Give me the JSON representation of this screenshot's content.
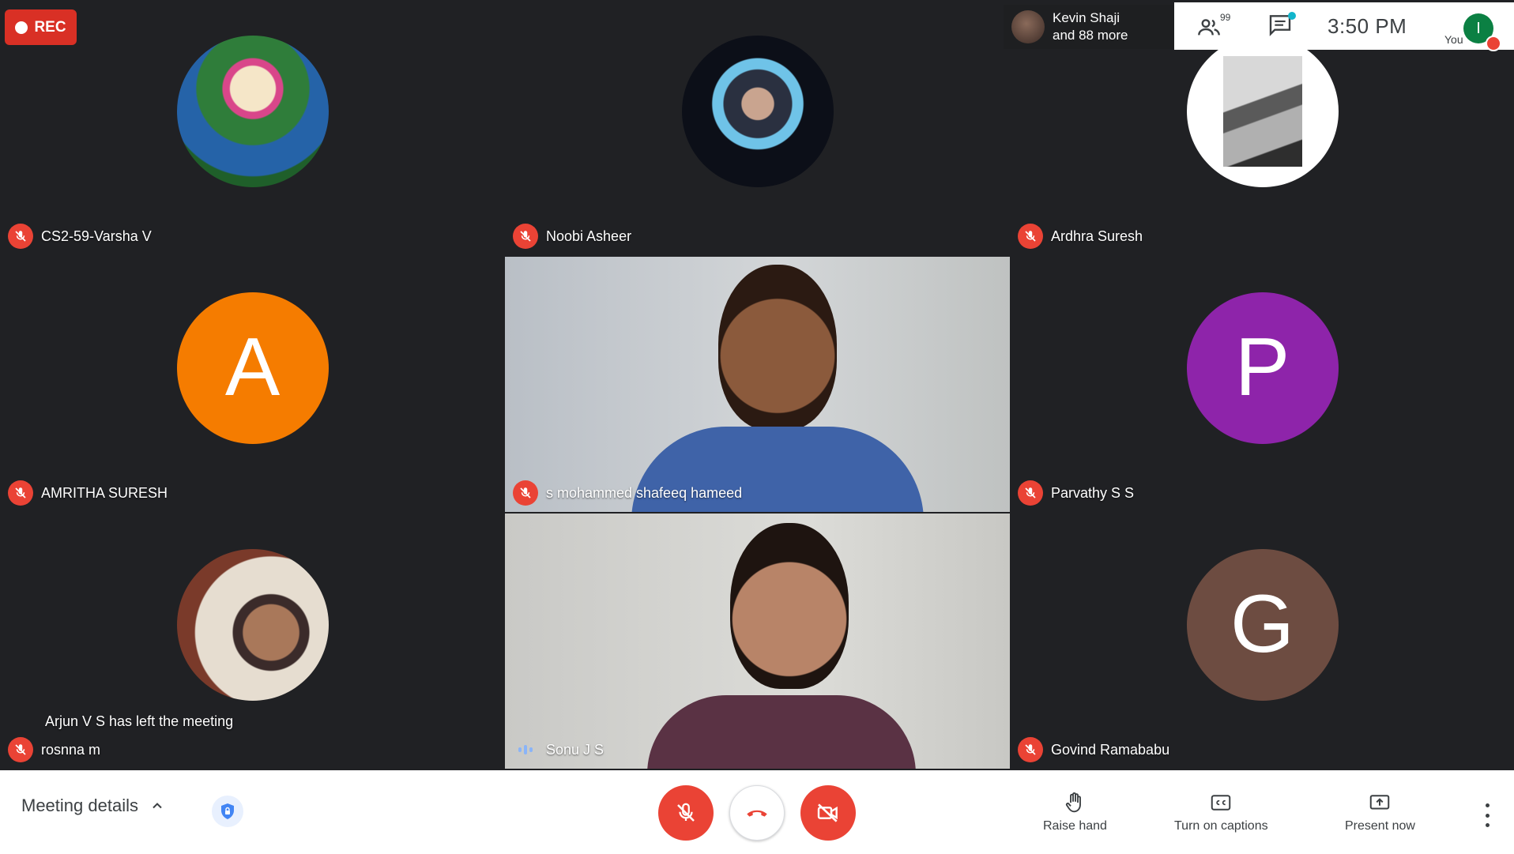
{
  "rec_label": "REC",
  "presenter": {
    "line1": "Kevin Shaji",
    "line2": "and 88 more"
  },
  "topbar": {
    "people_count": "99",
    "time": "3:50  PM",
    "you_label": "You",
    "you_initial": "I"
  },
  "participants": [
    {
      "name": "CS2-59-Varsha V",
      "kind": "photo",
      "mic": "muted"
    },
    {
      "name": "Noobi Asheer",
      "kind": "photo",
      "mic": "muted"
    },
    {
      "name": "Ardhra Suresh",
      "kind": "photo",
      "mic": "muted"
    },
    {
      "name": "AMRITHA SURESH",
      "kind": "letter",
      "initial": "A",
      "color": "#f57c00",
      "mic": "muted"
    },
    {
      "name": "s mohammed shafeeq hameed",
      "kind": "video",
      "mic": "muted"
    },
    {
      "name": "Parvathy S S",
      "kind": "letter",
      "initial": "P",
      "color": "#8e24aa",
      "mic": "muted"
    },
    {
      "name": "rosnna m",
      "kind": "photo",
      "mic": "muted"
    },
    {
      "name": "Sonu J S",
      "kind": "video",
      "mic": "speaking"
    },
    {
      "name": "Govind Ramababu",
      "kind": "letter",
      "initial": "G",
      "color": "#6d4c41",
      "mic": "muted"
    }
  ],
  "toast": "Arjun V S has left the meeting",
  "bottombar": {
    "meeting_details": "Meeting details",
    "raise_hand": "Raise hand",
    "captions": "Turn on captions",
    "present": "Present now"
  },
  "colors": {
    "mute_red": "#ea4335",
    "rec_red": "#d93025",
    "bg": "#202124"
  }
}
